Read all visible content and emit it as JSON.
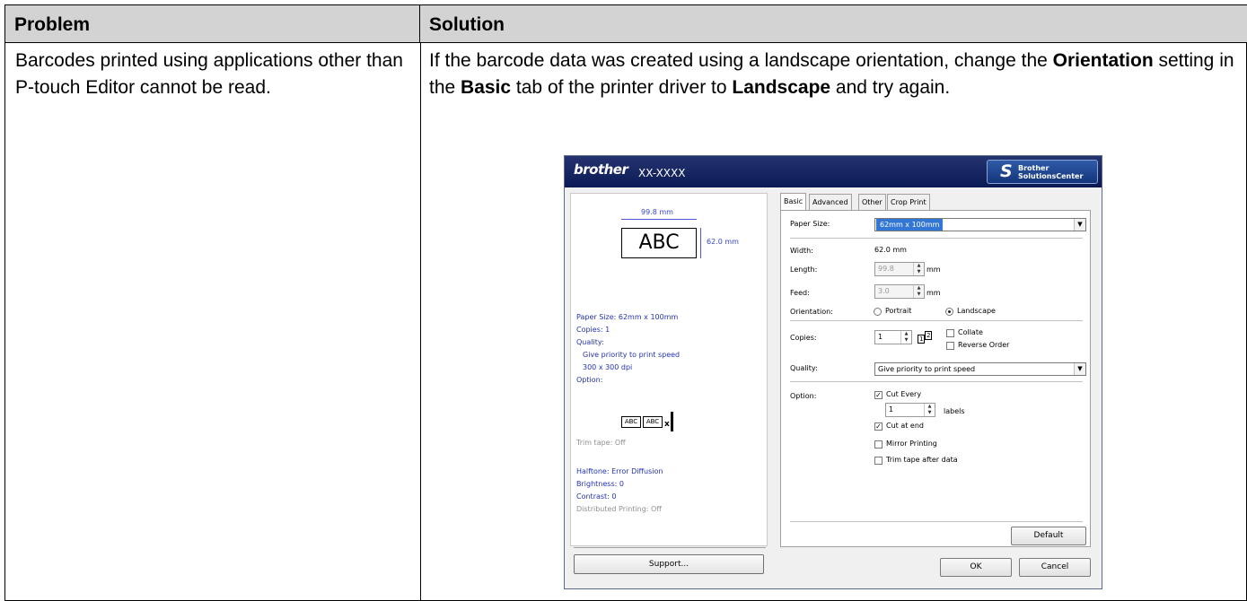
{
  "table": {
    "headers": {
      "problem": "Problem",
      "solution": "Solution"
    },
    "problem": "Barcodes printed using applications other than P-touch Editor cannot be read.",
    "solution": {
      "p1": "If the barcode data was created using a landscape orientation, change the ",
      "b1": "Orientation",
      "p2": " setting in the ",
      "b2": "Basic",
      "p3": " tab of the printer driver to ",
      "b3": "Landscape",
      "p4": " and try again."
    }
  },
  "dialog": {
    "brand": "brother",
    "model": "XX-XXXX",
    "solutions_center": {
      "line1": "Brother",
      "line2": "SolutionsCenter"
    },
    "preview": {
      "width_label": "99.8 mm",
      "height_label": "62.0 mm",
      "label_text": "ABC",
      "info": {
        "paper_size": "Paper Size: 62mm x 100mm",
        "copies": "Copies: 1",
        "quality": "Quality:",
        "quality_value": "Give priority to print speed",
        "dpi": "300 x 300 dpi",
        "option": "Option:",
        "cut_label": "ABC",
        "cut_x": "x",
        "trim_tape": "Trim tape: Off",
        "halftone": "Halftone: Error Diffusion",
        "brightness": "Brightness:  0",
        "contrast": "Contrast:  0",
        "distributed": "Distributed Printing: Off"
      },
      "support_button": "Support..."
    },
    "tabs": [
      "Basic",
      "Advanced",
      "Other",
      "Crop Print"
    ],
    "basic": {
      "paper_size_label": "Paper Size:",
      "paper_size_value": "62mm x 100mm",
      "width_label": "Width:",
      "width_value": "62.0 mm",
      "length_label": "Length:",
      "length_value": "99.8",
      "feed_label": "Feed:",
      "feed_value": "3.0",
      "unit": "mm",
      "orientation_label": "Orientation:",
      "portrait": "Portrait",
      "landscape": "Landscape",
      "copies_label": "Copies:",
      "copies_value": "1",
      "collate": "Collate",
      "reverse_order": "Reverse Order",
      "quality_label": "Quality:",
      "quality_value": "Give priority to print speed",
      "option_label": "Option:",
      "cut_every": "Cut Every",
      "cut_every_value": "1",
      "labels": "labels",
      "cut_at_end": "Cut at end",
      "mirror_printing": "Mirror Printing",
      "trim_tape_after_data": "Trim tape after data",
      "default_button": "Default"
    },
    "ok_button": "OK",
    "cancel_button": "Cancel",
    "arrow_glyph": "▼"
  }
}
